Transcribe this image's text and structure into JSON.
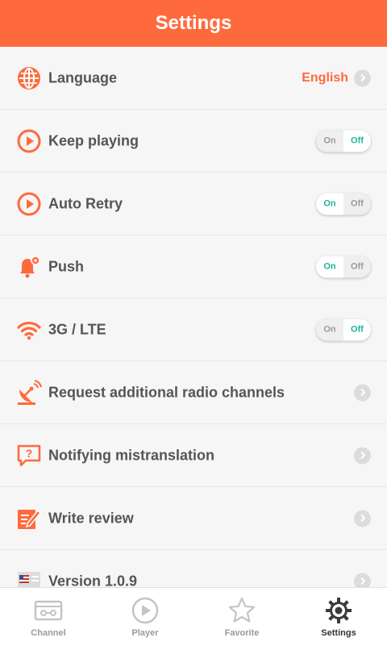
{
  "header": {
    "title": "Settings"
  },
  "colors": {
    "accent": "#ff6a3d",
    "toggle_active": "#19b89a"
  },
  "settings": {
    "language": {
      "label": "Language",
      "value": "English",
      "icon": "globe-icon"
    },
    "keep_playing": {
      "label": "Keep playing",
      "on": "On",
      "off": "Off",
      "state": "off",
      "icon": "play-circle-icon"
    },
    "auto_retry": {
      "label": "Auto Retry",
      "on": "On",
      "off": "Off",
      "state": "on",
      "icon": "play-circle-icon"
    },
    "push": {
      "label": "Push",
      "on": "On",
      "off": "Off",
      "state": "on",
      "icon": "bell-gear-icon"
    },
    "lte": {
      "label": "3G / LTE",
      "on": "On",
      "off": "Off",
      "state": "off",
      "icon": "wifi-icon"
    },
    "request": {
      "label": "Request additional radio channels",
      "icon": "satellite-dish-icon"
    },
    "mistranslation": {
      "label": "Notifying mistranslation",
      "icon": "question-bubble-icon"
    },
    "review": {
      "label": "Write review",
      "icon": "edit-note-icon"
    },
    "version": {
      "label": "Version  1.0.9",
      "icon": "flag-card-icon"
    }
  },
  "tabs": [
    {
      "label": "Channel",
      "icon": "radio-icon",
      "active": false
    },
    {
      "label": "Player",
      "icon": "play-circle-icon",
      "active": false
    },
    {
      "label": "Favorite",
      "icon": "star-icon",
      "active": false
    },
    {
      "label": "Settings",
      "icon": "gear-icon",
      "active": true
    }
  ]
}
